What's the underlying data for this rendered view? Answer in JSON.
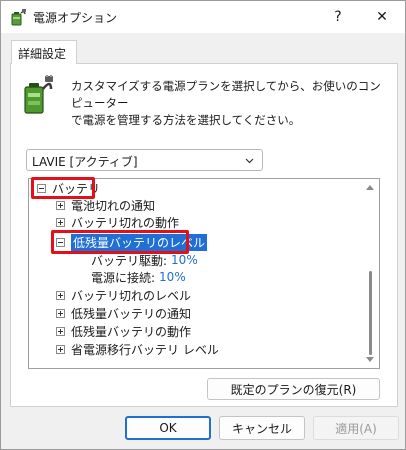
{
  "window": {
    "title": "電源オプション",
    "help": "?",
    "close": "✕"
  },
  "tab": {
    "label": "詳細設定"
  },
  "description": {
    "line1": "カスタマイズする電源プランを選択してから、お使いのコンピューター",
    "line2": "で電源を管理する方法を選択してください。"
  },
  "plan_select": {
    "value": "LAVIE [アクティブ]"
  },
  "tree": {
    "root": "バッテリ",
    "items": [
      "電池切れの通知",
      "バッテリ切れの動作",
      "低残量バッテリのレベル",
      "バッテリ切れのレベル",
      "低残量バッテリの通知",
      "低残量バッテリの動作",
      "省電源移行バッテリ レベル"
    ],
    "settings": [
      {
        "label": "バッテリ駆動:",
        "value": "10%"
      },
      {
        "label": "電源に接続:",
        "value": "10%"
      }
    ]
  },
  "buttons": {
    "restore": "既定のプランの復元(R)",
    "ok": "OK",
    "cancel": "キャンセル",
    "apply": "適用(A)"
  },
  "colors": {
    "accent": "#1f6fd6",
    "highlight_box": "#e30f1a"
  },
  "icons": {
    "app": "battery-plug-icon",
    "description": "battery-plug-icon",
    "dropdown": "chevron-down-icon"
  }
}
